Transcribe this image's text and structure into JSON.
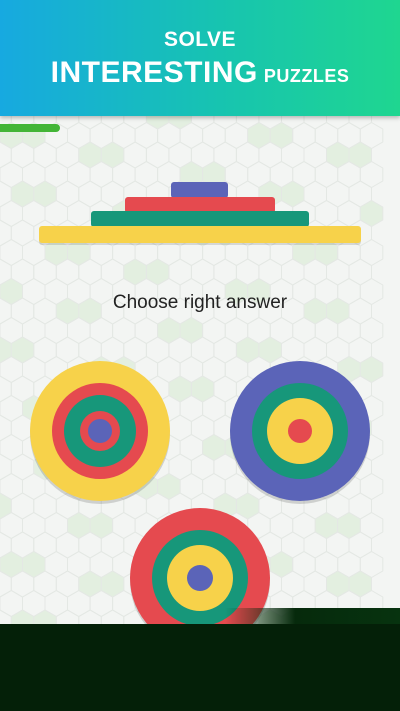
{
  "banner": {
    "line1": "SOLVE",
    "line2_big": "INTERESTING",
    "line2_small": "PUZZLES"
  },
  "progress": {
    "fraction": 0.15,
    "color": "#43b536"
  },
  "question": "Choose right answer",
  "colors": {
    "navy": "#5b64b8",
    "red": "#e54a4f",
    "teal": "#17977a",
    "yellow": "#f7d24a"
  },
  "stack_top_to_bottom": [
    "navy",
    "red",
    "teal",
    "yellow"
  ],
  "answers": [
    {
      "name": "answer-option-1",
      "rings_outer_to_inner": [
        "yellow",
        "red",
        "teal",
        "red",
        "navy"
      ]
    },
    {
      "name": "answer-option-2",
      "rings_outer_to_inner": [
        "navy",
        "teal",
        "yellow",
        "red"
      ]
    },
    {
      "name": "answer-option-3",
      "rings_outer_to_inner": [
        "red",
        "teal",
        "yellow",
        "navy"
      ]
    }
  ]
}
